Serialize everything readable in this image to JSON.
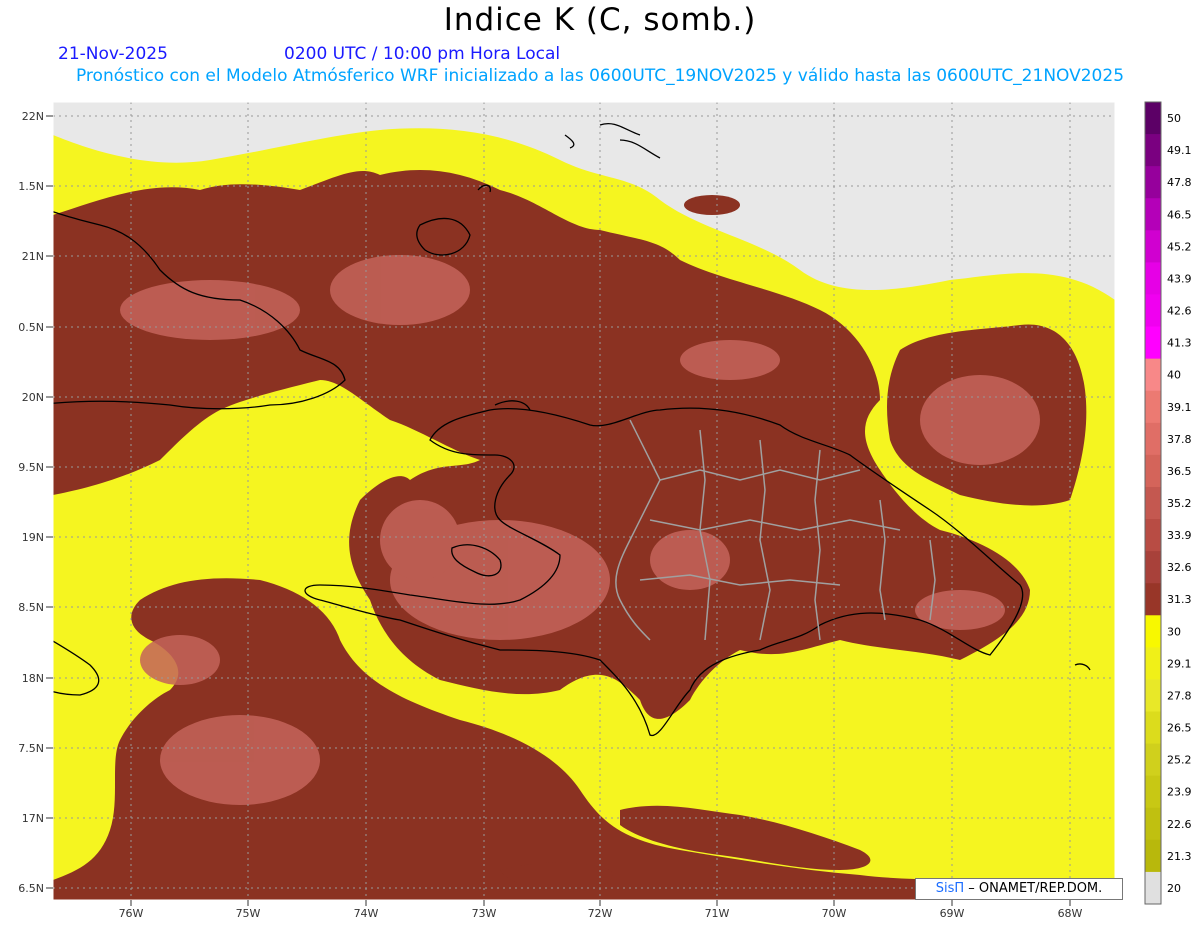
{
  "header": {
    "title": "Indice K (C, somb.)",
    "date": "21-Nov-2025",
    "time": "0200 UTC / 10:00 pm Hora Local",
    "subtitle": "Pronóstico con el Modelo Atmósferico WRF inicializado a las 0600UTC_19NOV2025 y válido hasta las  0600UTC_21NOV2025"
  },
  "map": {
    "lat_labels": [
      "22N",
      "1.5N",
      "21N",
      "0.5N",
      "20N",
      "9.5N",
      "19N",
      "8.5N",
      "18N",
      "7.5N",
      "17N",
      "6.5N"
    ],
    "lon_labels": [
      "76W",
      "75W",
      "74W",
      "73W",
      "72W",
      "71W",
      "70W",
      "69W",
      "68W"
    ],
    "colors": {
      "no_data": "#e8e8e8",
      "yellow": "#f5f520",
      "brown": "#8b3222",
      "salmon": "#c4645a",
      "coast": "#000000",
      "border": "#a0a0a0"
    }
  },
  "colorbar": {
    "labels": [
      "50",
      "49.1",
      "47.8",
      "46.5",
      "45.2",
      "43.9",
      "42.6",
      "41.3",
      "40",
      "39.1",
      "37.8",
      "36.5",
      "35.2",
      "33.9",
      "32.6",
      "31.3",
      "30",
      "29.1",
      "27.8",
      "26.5",
      "25.2",
      "23.9",
      "22.6",
      "21.3",
      "20"
    ],
    "colors": [
      "#5c0066",
      "#7a0080",
      "#96009c",
      "#b400b8",
      "#d000d0",
      "#e600e6",
      "#f000f0",
      "#ff00ff",
      "#f88888",
      "#ec7a72",
      "#e06e66",
      "#d4645a",
      "#c45850",
      "#b84c44",
      "#a8413a",
      "#983628",
      "#f8f800",
      "#f0f018",
      "#e8e828",
      "#dcdc1c",
      "#d0d01c",
      "#c8c814",
      "#c0c010",
      "#b8b80c",
      "#e0e0e0"
    ]
  },
  "credit": {
    "sis": "SisΠ",
    "rest": "– ONAMET/REP.DOM."
  }
}
